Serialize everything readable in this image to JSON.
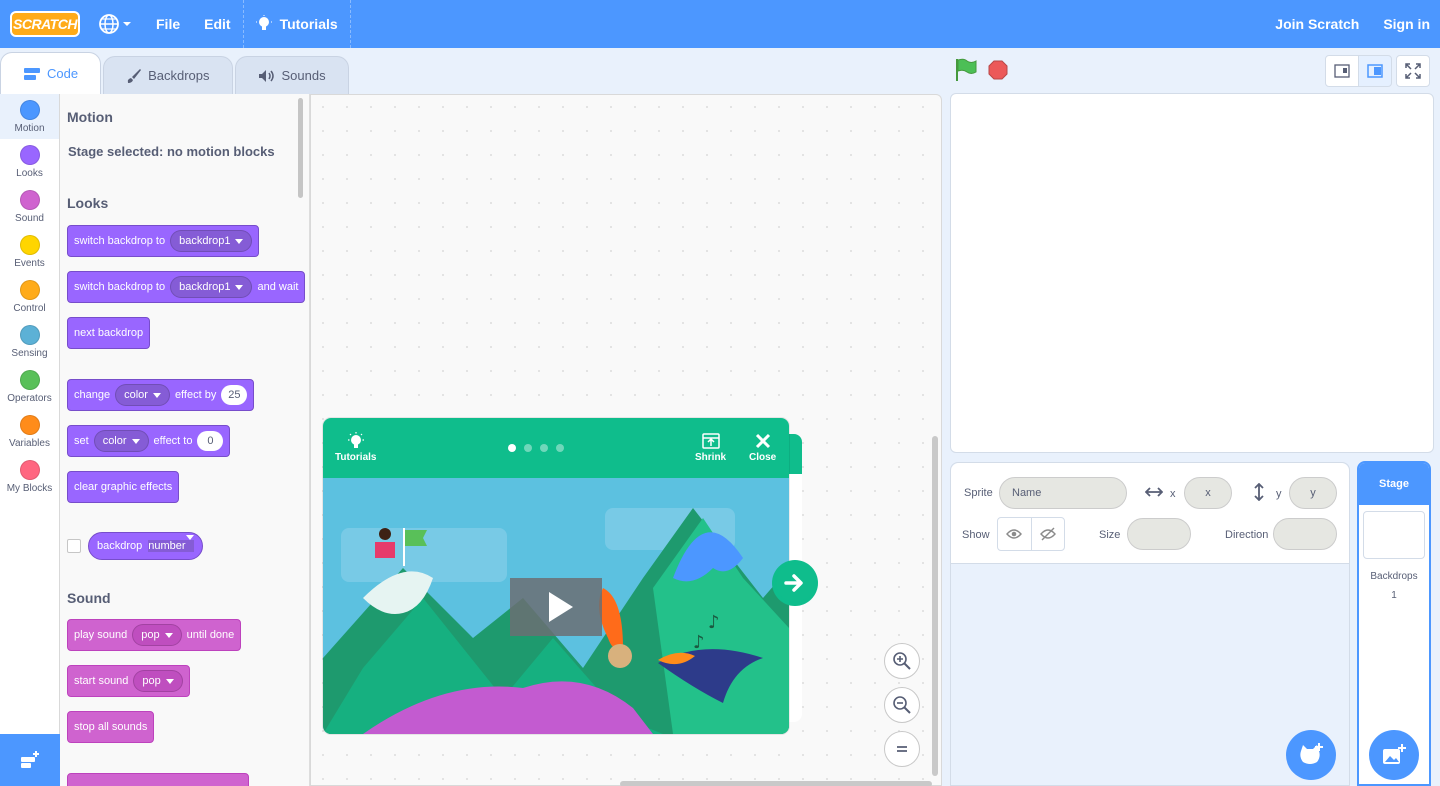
{
  "menu": {
    "logo_text": "SCRATCH",
    "file": "File",
    "edit": "Edit",
    "tutorials": "Tutorials",
    "join": "Join Scratch",
    "sign_in": "Sign in"
  },
  "tabs": {
    "code": "Code",
    "backdrops": "Backdrops",
    "sounds": "Sounds"
  },
  "categories": [
    {
      "label": "Motion",
      "color": "#4c97ff"
    },
    {
      "label": "Looks",
      "color": "#9966ff"
    },
    {
      "label": "Sound",
      "color": "#cf63cf"
    },
    {
      "label": "Events",
      "color": "#ffd500"
    },
    {
      "label": "Control",
      "color": "#ffab19"
    },
    {
      "label": "Sensing",
      "color": "#5cb1d6"
    },
    {
      "label": "Operators",
      "color": "#59c059"
    },
    {
      "label": "Variables",
      "color": "#ff8c1a"
    },
    {
      "label": "My Blocks",
      "color": "#ff6680"
    }
  ],
  "palette": {
    "motion_title": "Motion",
    "motion_note": "Stage selected: no motion blocks",
    "looks_title": "Looks",
    "switch_backdrop": "switch backdrop to",
    "backdrop_value": "backdrop1",
    "and_wait": "and wait",
    "next_backdrop": "next backdrop",
    "change": "change",
    "color_value": "color",
    "effect_by": "effect by",
    "change_amount": "25",
    "set": "set",
    "effect_to": "effect to",
    "set_amount": "0",
    "clear_effects": "clear graphic effects",
    "backdrop": "backdrop",
    "number_value": "number",
    "sound_title": "Sound",
    "play_sound": "play sound",
    "pop_value": "pop",
    "until_done": "until done",
    "start_sound": "start sound",
    "stop_all_sounds": "stop all sounds"
  },
  "tutorial_card": {
    "tutorials": "Tutorials",
    "shrink": "Shrink",
    "close": "Close",
    "steps": 4,
    "current_step": 1
  },
  "sprite_info": {
    "sprite_label": "Sprite",
    "name_placeholder": "Name",
    "x_label": "x",
    "x_placeholder": "x",
    "y_label": "y",
    "y_placeholder": "y",
    "show_label": "Show",
    "size_label": "Size",
    "direction_label": "Direction"
  },
  "stage_selector": {
    "title": "Stage",
    "backdrops_label": "Backdrops",
    "backdrops_count": "1"
  }
}
